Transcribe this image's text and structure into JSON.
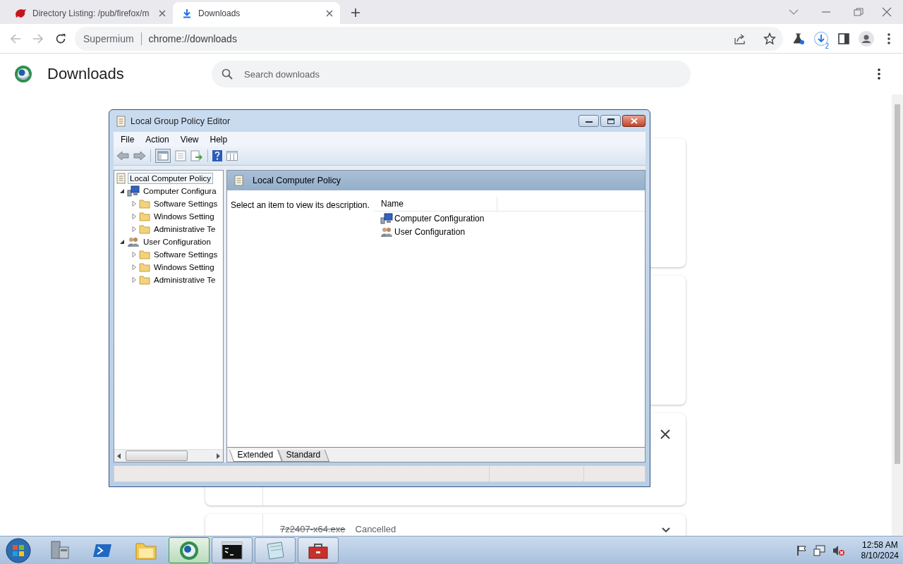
{
  "browser": {
    "tabs": [
      {
        "title": "Directory Listing: /pub/firefox/m",
        "kind": "site",
        "selected": false
      },
      {
        "title": "Downloads",
        "kind": "download",
        "selected": true
      }
    ],
    "address": {
      "site": "Supermium",
      "url": "chrome://downloads"
    },
    "downloads_badge": "2"
  },
  "downloads_page": {
    "title": "Downloads",
    "search": {
      "placeholder": "Search downloads"
    },
    "items": [
      {
        "kind": "blank"
      },
      {
        "kind": "blank"
      },
      {
        "kind": "removable"
      },
      {
        "kind": "cancelled",
        "filename": "7z2407-x64.exe",
        "status": "Cancelled"
      }
    ]
  },
  "editor": {
    "title": "Local Group Policy Editor",
    "menu": [
      "File",
      "Action",
      "View",
      "Help"
    ],
    "tree": [
      {
        "label": "Local Computer Policy",
        "kind": "policy",
        "selected": true,
        "children": [
          {
            "label": "Computer Configura",
            "kind": "computer",
            "selected": false,
            "expanded": true,
            "children": [
              {
                "label": "Software Settings",
                "kind": "folder",
                "selected": false,
                "expanded": false
              },
              {
                "label": "Windows Setting",
                "kind": "folder",
                "selected": false,
                "expanded": false
              },
              {
                "label": "Administrative Te",
                "kind": "folder",
                "selected": false,
                "expanded": false
              }
            ]
          },
          {
            "label": "User Configuration",
            "kind": "user",
            "selected": false,
            "expanded": true,
            "children": [
              {
                "label": "Software Settings",
                "kind": "folder",
                "selected": false,
                "expanded": false
              },
              {
                "label": "Windows Setting",
                "kind": "folder",
                "selected": false,
                "expanded": false
              },
              {
                "label": "Administrative Te",
                "kind": "folder",
                "selected": false,
                "expanded": false
              }
            ]
          }
        ]
      }
    ],
    "header": "Local Computer Policy",
    "description": "Select an item to view its description.",
    "columns": [
      "Name"
    ],
    "items": [
      {
        "label": "Computer Configuration",
        "kind": "computer"
      },
      {
        "label": "User Configuration",
        "kind": "user"
      }
    ],
    "view_tabs": [
      {
        "label": "Extended",
        "selected": true
      },
      {
        "label": "Standard",
        "selected": false
      }
    ]
  },
  "taskbar": {
    "apps": [
      {
        "kind": "server",
        "running": false,
        "selected": false
      },
      {
        "kind": "powershell",
        "running": false,
        "selected": false
      },
      {
        "kind": "folder",
        "running": false,
        "selected": false
      },
      {
        "kind": "browser",
        "running": true,
        "selected": true
      },
      {
        "kind": "terminal",
        "running": true,
        "selected": false
      },
      {
        "kind": "notepad",
        "running": true,
        "selected": false
      },
      {
        "kind": "toolbox",
        "running": true,
        "selected": false
      }
    ],
    "time": "12:58 AM",
    "date": "8/10/2024"
  }
}
